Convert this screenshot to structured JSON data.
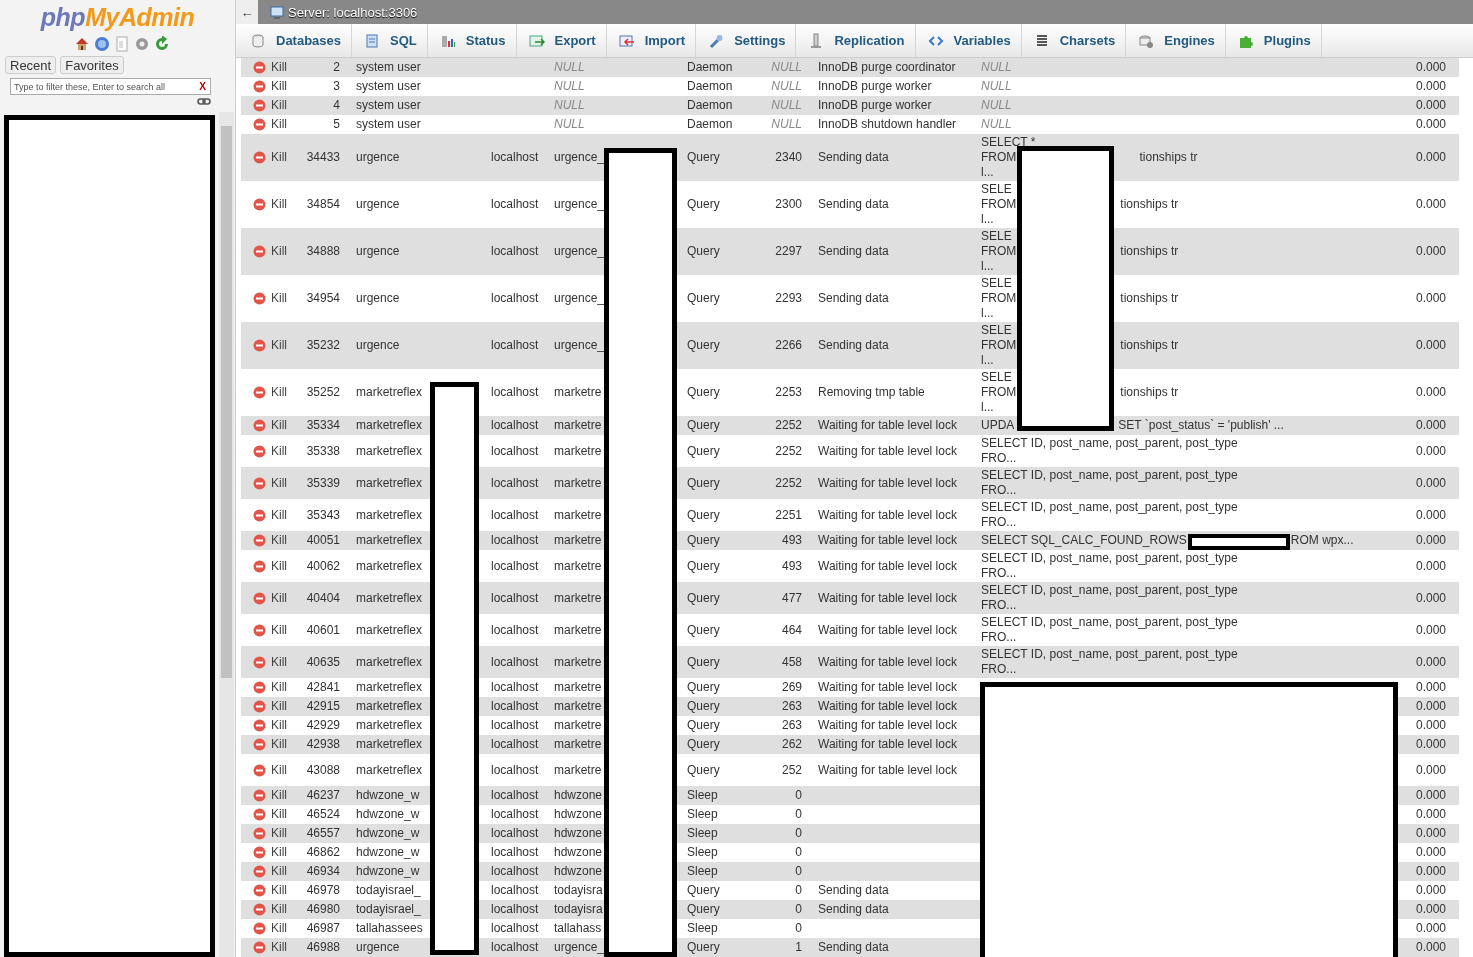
{
  "sidebar": {
    "logo": [
      "php",
      "MyAdmin"
    ],
    "buttons": [
      "Recent",
      "Favorites"
    ],
    "filter": {
      "placeholder": "Type to filter these, Enter to search all",
      "clear": "X"
    }
  },
  "header": {
    "back": "←",
    "title": "Server: localhost:3306"
  },
  "tabs": [
    {
      "label": "Databases"
    },
    {
      "label": "SQL"
    },
    {
      "label": "Status"
    },
    {
      "label": "Export"
    },
    {
      "label": "Import"
    },
    {
      "label": "Settings"
    },
    {
      "label": "Replication"
    },
    {
      "label": "Variables"
    },
    {
      "label": "Charsets"
    },
    {
      "label": "Engines"
    },
    {
      "label": "Plugins"
    }
  ],
  "processes": [
    {
      "kind": "daemon",
      "kill": "Kill",
      "id": "2",
      "user": "system user",
      "db": "NULL",
      "command": "Daemon",
      "time": "NULL",
      "state": "InnoDB purge coordinator",
      "info": [
        "NULL"
      ],
      "progress": "0.000"
    },
    {
      "kind": "daemon",
      "kill": "Kill",
      "id": "3",
      "user": "system user",
      "db": "NULL",
      "command": "Daemon",
      "time": "NULL",
      "state": "InnoDB purge worker",
      "info": [
        "NULL"
      ],
      "progress": "0.000"
    },
    {
      "kind": "daemon",
      "kill": "Kill",
      "id": "4",
      "user": "system user",
      "db": "NULL",
      "command": "Daemon",
      "time": "NULL",
      "state": "InnoDB purge worker",
      "info": [
        "NULL"
      ],
      "progress": "0.000"
    },
    {
      "kind": "daemon",
      "kill": "Kill",
      "id": "5",
      "user": "system user",
      "db": "NULL",
      "command": "Daemon",
      "time": "NULL",
      "state": "InnoDB shutdown handler",
      "info": [
        "NULL"
      ],
      "progress": "0.000"
    },
    {
      "kind": "triple",
      "kill": "Kill",
      "id": "34433",
      "user": "urgence",
      "host": "localhost",
      "db": "urgence_",
      "command": "Query",
      "time": "2340",
      "state": "Sending data",
      "info": [
        "SELECT *",
        "FROM",
        "l..."
      ],
      "info_after": "tionships tr",
      "progress": "0.000"
    },
    {
      "kind": "triple",
      "kill": "Kill",
      "id": "34854",
      "user": "urgence",
      "host": "localhost",
      "db": "urgence_",
      "command": "Query",
      "time": "2300",
      "state": "Sending data",
      "info": [
        "SELE",
        "FROM",
        "l..."
      ],
      "info_after": "tionships tr",
      "progress": "0.000"
    },
    {
      "kind": "triple",
      "kill": "Kill",
      "id": "34888",
      "user": "urgence",
      "host": "localhost",
      "db": "urgence_",
      "command": "Query",
      "time": "2297",
      "state": "Sending data",
      "info": [
        "SELE",
        "FROM",
        "l..."
      ],
      "info_after": "tionships tr",
      "progress": "0.000"
    },
    {
      "kind": "triple",
      "kill": "Kill",
      "id": "34954",
      "user": "urgence",
      "host": "localhost",
      "db": "urgence_",
      "command": "Query",
      "time": "2293",
      "state": "Sending data",
      "info": [
        "SELE",
        "FROM",
        "l..."
      ],
      "info_after": "tionships tr",
      "progress": "0.000"
    },
    {
      "kind": "triple",
      "kill": "Kill",
      "id": "35232",
      "user": "urgence",
      "host": "localhost",
      "db": "urgence_",
      "command": "Query",
      "time": "2266",
      "state": "Sending data",
      "info": [
        "SELE",
        "FROM",
        "l..."
      ],
      "info_after": "tionships tr",
      "progress": "0.000"
    },
    {
      "kind": "triple",
      "kill": "Kill",
      "id": "35252",
      "user": "marketreflex",
      "host": "localhost",
      "db": "marketre",
      "command": "Query",
      "time": "2253",
      "state": "Removing tmp table",
      "info": [
        "SELE",
        "FROM",
        "l..."
      ],
      "info_after": "tionships tr",
      "progress": "0.000"
    },
    {
      "kind": "single",
      "kill": "Kill",
      "id": "35334",
      "user": "marketreflex",
      "host": "localhost",
      "db": "marketre",
      "command": "Query",
      "time": "2252",
      "state": "Waiting for table level lock",
      "info": [
        "UPDA"
      ],
      "info_after": "SET `post_status` = 'publish' ...",
      "progress": "0.000"
    },
    {
      "kind": "double",
      "kill": "Kill",
      "id": "35338",
      "user": "marketreflex",
      "host": "localhost",
      "db": "marketre",
      "command": "Query",
      "time": "2252",
      "state": "Waiting for table level lock",
      "info": [
        "SELECT ID, post_name, post_parent, post_type",
        "FRO..."
      ],
      "progress": "0.000"
    },
    {
      "kind": "double",
      "kill": "Kill",
      "id": "35339",
      "user": "marketreflex",
      "host": "localhost",
      "db": "marketre",
      "command": "Query",
      "time": "2252",
      "state": "Waiting for table level lock",
      "info": [
        "SELECT ID, post_name, post_parent, post_type",
        "FRO..."
      ],
      "progress": "0.000"
    },
    {
      "kind": "double",
      "kill": "Kill",
      "id": "35343",
      "user": "marketreflex",
      "host": "localhost",
      "db": "marketre",
      "command": "Query",
      "time": "2251",
      "state": "Waiting for table level lock",
      "info": [
        "SELECT ID, post_name, post_parent, post_type",
        "FRO..."
      ],
      "progress": "0.000"
    },
    {
      "kind": "single",
      "kill": "Kill",
      "id": "40051",
      "user": "marketreflex",
      "host": "localhost",
      "db": "marketre",
      "command": "Query",
      "time": "493",
      "state": "Waiting for table level lock",
      "info": [
        "SELECT SQL_CALC_FOUND_ROWS"
      ],
      "info_after": "ROM wpx...",
      "progress": "0.000"
    },
    {
      "kind": "double",
      "kill": "Kill",
      "id": "40062",
      "user": "marketreflex",
      "host": "localhost",
      "db": "marketre",
      "command": "Query",
      "time": "493",
      "state": "Waiting for table level lock",
      "info": [
        "SELECT ID, post_name, post_parent, post_type",
        "FRO..."
      ],
      "progress": "0.000"
    },
    {
      "kind": "double",
      "kill": "Kill",
      "id": "40404",
      "user": "marketreflex",
      "host": "localhost",
      "db": "marketre",
      "command": "Query",
      "time": "477",
      "state": "Waiting for table level lock",
      "info": [
        "SELECT ID, post_name, post_parent, post_type",
        "FRO..."
      ],
      "progress": "0.000"
    },
    {
      "kind": "double",
      "kill": "Kill",
      "id": "40601",
      "user": "marketreflex",
      "host": "localhost",
      "db": "marketre",
      "command": "Query",
      "time": "464",
      "state": "Waiting for table level lock",
      "info": [
        "SELECT ID, post_name, post_parent, post_type",
        "FRO..."
      ],
      "progress": "0.000"
    },
    {
      "kind": "double",
      "kill": "Kill",
      "id": "40635",
      "user": "marketreflex",
      "host": "localhost",
      "db": "marketre",
      "command": "Query",
      "time": "458",
      "state": "Waiting for table level lock",
      "info": [
        "SELECT ID, post_name, post_parent, post_type",
        "FRO..."
      ],
      "progress": "0.000"
    },
    {
      "kind": "single",
      "kill": "Kill",
      "id": "42841",
      "user": "marketreflex",
      "host": "localhost",
      "db": "marketre",
      "command": "Query",
      "time": "269",
      "state": "Waiting for table level lock",
      "progress": "0.000"
    },
    {
      "kind": "single",
      "kill": "Kill",
      "id": "42915",
      "user": "marketreflex",
      "host": "localhost",
      "db": "marketre",
      "command": "Query",
      "time": "263",
      "state": "Waiting for table level lock",
      "progress": "0.000"
    },
    {
      "kind": "single",
      "kill": "Kill",
      "id": "42929",
      "user": "marketreflex",
      "host": "localhost",
      "db": "marketre",
      "command": "Query",
      "time": "263",
      "state": "Waiting for table level lock",
      "progress": "0.000"
    },
    {
      "kind": "single",
      "kill": "Kill",
      "id": "42938",
      "user": "marketreflex",
      "host": "localhost",
      "db": "marketre",
      "command": "Query",
      "time": "262",
      "state": "Waiting for table level lock",
      "progress": "0.000"
    },
    {
      "kind": "double",
      "kill": "Kill",
      "id": "43088",
      "user": "marketreflex",
      "host": "localhost",
      "db": "marketre",
      "command": "Query",
      "time": "252",
      "state": "Waiting for table level lock",
      "progress": "0.000"
    },
    {
      "kind": "single",
      "kill": "Kill",
      "id": "46237",
      "user": "hdwzone_w",
      "host": "localhost",
      "db": "hdwzone",
      "command": "Sleep",
      "time": "0",
      "progress": "0.000"
    },
    {
      "kind": "single",
      "kill": "Kill",
      "id": "46524",
      "user": "hdwzone_w",
      "host": "localhost",
      "db": "hdwzone",
      "command": "Sleep",
      "time": "0",
      "progress": "0.000"
    },
    {
      "kind": "single",
      "kill": "Kill",
      "id": "46557",
      "user": "hdwzone_w",
      "host": "localhost",
      "db": "hdwzone",
      "command": "Sleep",
      "time": "0",
      "progress": "0.000"
    },
    {
      "kind": "single",
      "kill": "Kill",
      "id": "46862",
      "user": "hdwzone_w",
      "host": "localhost",
      "db": "hdwzone",
      "command": "Sleep",
      "time": "0",
      "progress": "0.000"
    },
    {
      "kind": "single",
      "kill": "Kill",
      "id": "46934",
      "user": "hdwzone_w",
      "host": "localhost",
      "db": "hdwzone",
      "command": "Sleep",
      "time": "0",
      "progress": "0.000"
    },
    {
      "kind": "single",
      "kill": "Kill",
      "id": "46978",
      "user": "todayisrael_",
      "host": "localhost",
      "db": "todayisra",
      "command": "Query",
      "time": "0",
      "state": "Sending data",
      "progress": "0.000"
    },
    {
      "kind": "single",
      "kill": "Kill",
      "id": "46980",
      "user": "todayisrael_",
      "host": "localhost",
      "db": "todayisra",
      "command": "Query",
      "time": "0",
      "state": "Sending data",
      "progress": "0.000"
    },
    {
      "kind": "single",
      "kill": "Kill",
      "id": "46987",
      "user": "tallahassees",
      "host": "localhost",
      "db": "tallahass",
      "command": "Sleep",
      "time": "0",
      "progress": "0.000"
    },
    {
      "kind": "single",
      "kill": "Kill",
      "id": "46988",
      "user": "urgence",
      "host": "localhost",
      "db": "urgence_",
      "command": "Query",
      "time": "1",
      "state": "Sending data",
      "progress": "0.000"
    }
  ],
  "redactions": [
    {
      "kind": "sidebar"
    },
    {
      "kind": "user-column"
    },
    {
      "kind": "db-column"
    },
    {
      "kind": "info-top"
    },
    {
      "kind": "info-inline"
    },
    {
      "kind": "info-bottom"
    }
  ]
}
